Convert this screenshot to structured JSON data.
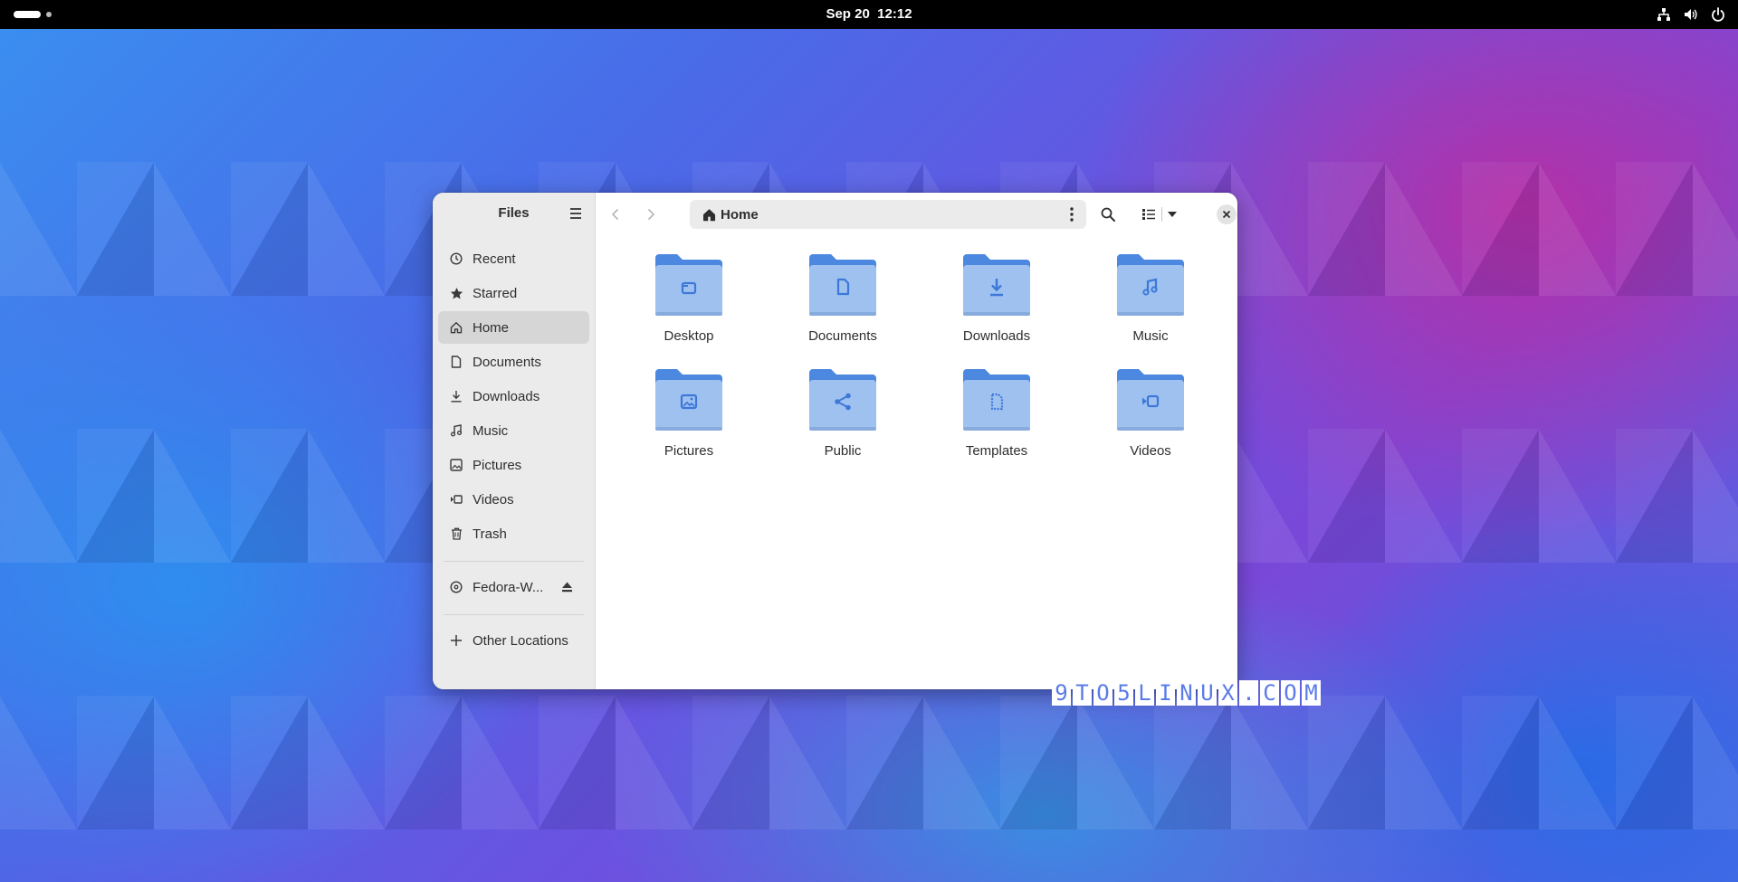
{
  "topbar": {
    "date": "Sep 20",
    "time": "12:12"
  },
  "window": {
    "sidebar": {
      "title": "Files",
      "places": [
        {
          "label": "Recent",
          "icon": "clock-icon"
        },
        {
          "label": "Starred",
          "icon": "star-icon"
        },
        {
          "label": "Home",
          "icon": "home-icon",
          "active": true
        },
        {
          "label": "Documents",
          "icon": "document-icon"
        },
        {
          "label": "Downloads",
          "icon": "download-icon"
        },
        {
          "label": "Music",
          "icon": "music-icon"
        },
        {
          "label": "Pictures",
          "icon": "picture-icon"
        },
        {
          "label": "Videos",
          "icon": "video-icon"
        },
        {
          "label": "Trash",
          "icon": "trash-icon"
        }
      ],
      "drive": {
        "label": "Fedora-W...",
        "icon": "disc-icon"
      },
      "other_locations": "Other Locations"
    },
    "pathbar": {
      "location": "Home"
    },
    "folders": [
      {
        "label": "Desktop",
        "emblem": "folder"
      },
      {
        "label": "Documents",
        "emblem": "document"
      },
      {
        "label": "Downloads",
        "emblem": "download"
      },
      {
        "label": "Music",
        "emblem": "music"
      },
      {
        "label": "Pictures",
        "emblem": "picture"
      },
      {
        "label": "Public",
        "emblem": "share"
      },
      {
        "label": "Templates",
        "emblem": "template"
      },
      {
        "label": "Videos",
        "emblem": "video"
      }
    ]
  },
  "colors": {
    "folder_back": "#4c88e0",
    "folder_front": "#9ec1f0",
    "emblem": "#3d78d8",
    "sidebar_bg": "#ebebeb",
    "active_bg": "#d6d6d6"
  },
  "watermark": [
    "9",
    "T",
    "O",
    "5",
    "L",
    "I",
    "N",
    "U",
    "X",
    ".",
    "C",
    "O",
    "M"
  ]
}
